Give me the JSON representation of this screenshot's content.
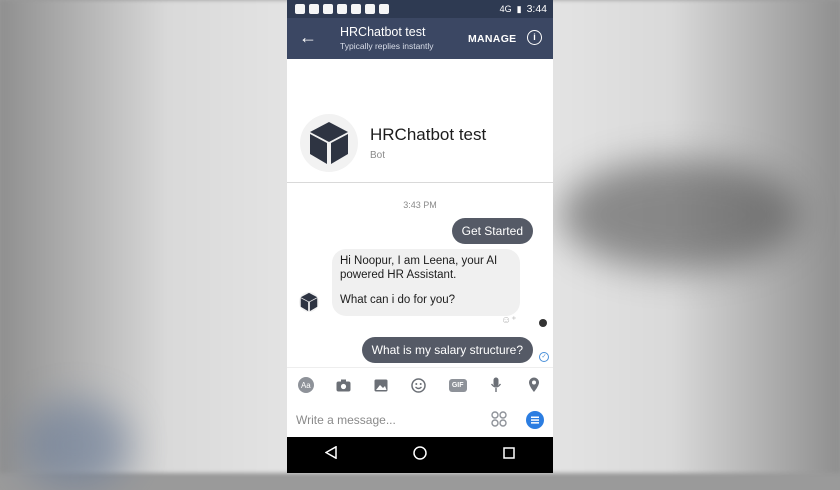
{
  "status_bar": {
    "time": "3:44",
    "network": "4G"
  },
  "header": {
    "title": "HRChatbot test",
    "subtitle": "Typically replies instantly",
    "manage_label": "MANAGE"
  },
  "profile": {
    "name": "HRChatbot test",
    "role": "Bot"
  },
  "conversation": {
    "timestamp": "3:43 PM",
    "messages": [
      {
        "from": "user",
        "text": "Get Started"
      },
      {
        "from": "bot",
        "lines": [
          "Hi Noopur, I am Leena, your AI powered HR Assistant.",
          "What can i do for you?"
        ]
      },
      {
        "from": "user",
        "text": "What is my salary structure?"
      }
    ]
  },
  "toolbar": {
    "icons": [
      "text-style-icon",
      "camera-icon",
      "gallery-icon",
      "emoji-icon",
      "gif-icon",
      "mic-icon",
      "location-icon"
    ],
    "text_label": "Aa",
    "gif_label": "GIF"
  },
  "composer": {
    "placeholder": "Write a message..."
  },
  "colors": {
    "header": "#3b4763",
    "status_bar": "#2e3a52",
    "user_bubble": "#555a66",
    "bot_bubble": "#f0f0f0",
    "accent": "#2b7de1"
  }
}
